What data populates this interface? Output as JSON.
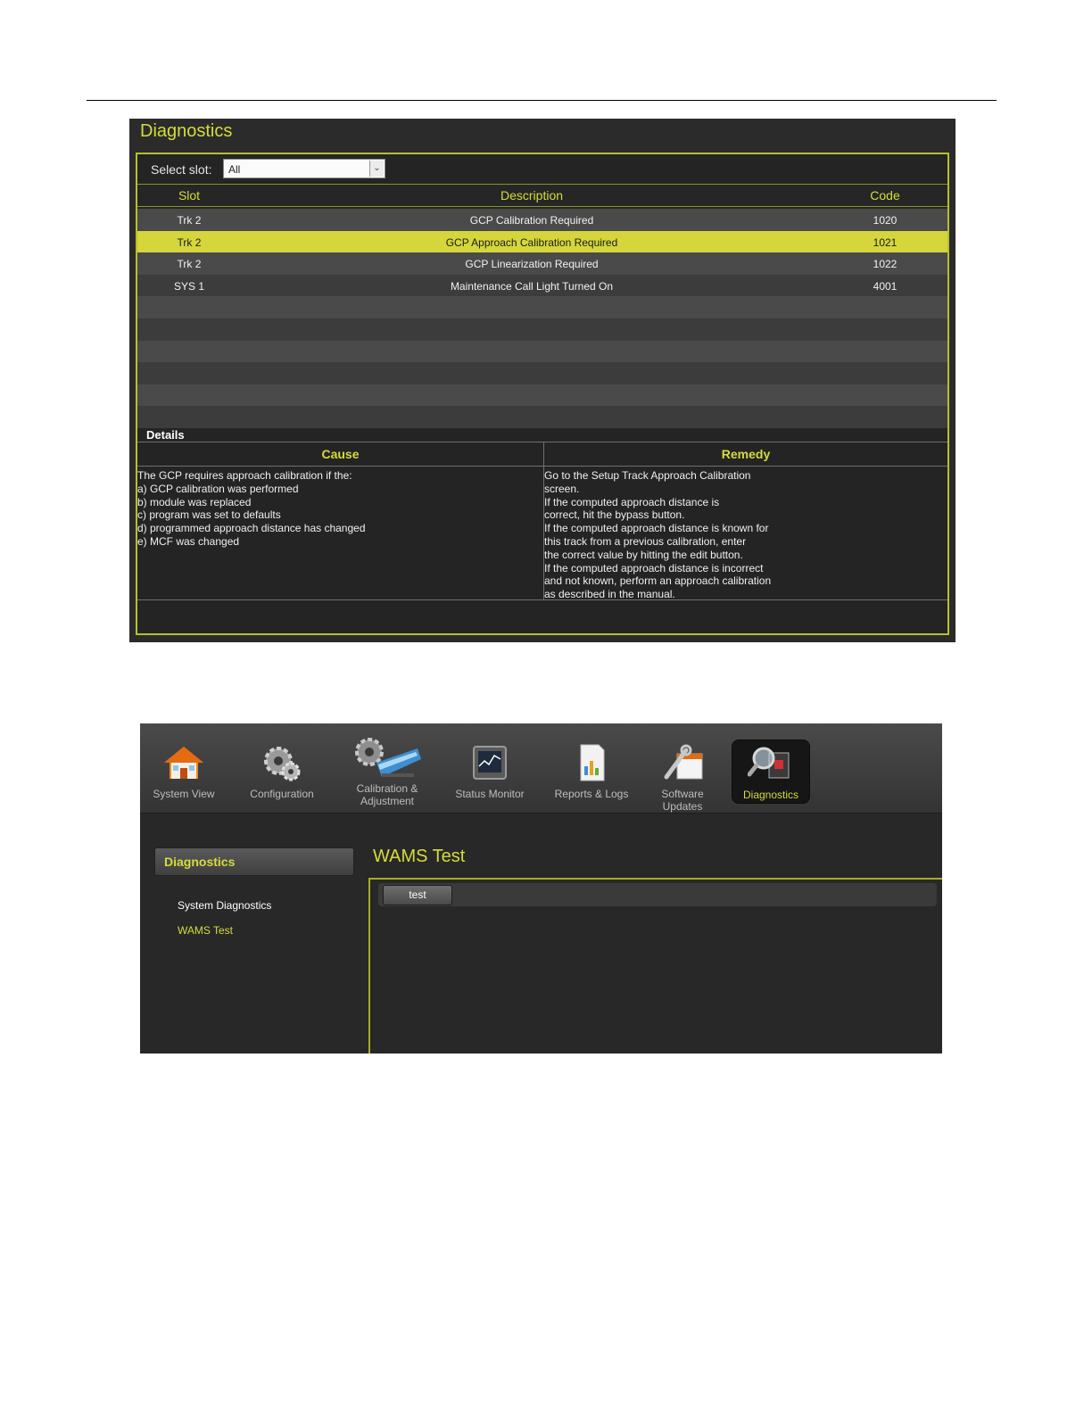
{
  "diagnostics_screen": {
    "title": "Diagnostics",
    "select_slot_label": "Select slot:",
    "select_slot_value": "All",
    "columns": {
      "slot": "Slot",
      "description": "Description",
      "code": "Code"
    },
    "rows": [
      {
        "slot": "Trk 2",
        "description": "GCP Calibration Required",
        "code": "1020",
        "selected": false
      },
      {
        "slot": "Trk 2",
        "description": "GCP Approach Calibration Required",
        "code": "1021",
        "selected": true
      },
      {
        "slot": "Trk 2",
        "description": "GCP Linearization Required",
        "code": "1022",
        "selected": false
      },
      {
        "slot": "SYS 1",
        "description": "Maintenance Call Light Turned On",
        "code": "4001",
        "selected": false
      },
      {
        "slot": "",
        "description": "",
        "code": "",
        "selected": false
      },
      {
        "slot": "",
        "description": "",
        "code": "",
        "selected": false
      },
      {
        "slot": "",
        "description": "",
        "code": "",
        "selected": false
      },
      {
        "slot": "",
        "description": "",
        "code": "",
        "selected": false
      },
      {
        "slot": "",
        "description": "",
        "code": "",
        "selected": false
      },
      {
        "slot": "",
        "description": "",
        "code": "",
        "selected": false
      }
    ],
    "details": {
      "label": "Details",
      "cause_header": "Cause",
      "remedy_header": "Remedy",
      "cause_lines": [
        "The GCP requires approach calibration if the:",
        "a) GCP calibration was performed",
        "b) module was replaced",
        "c) program was set to defaults",
        "d) programmed approach distance has changed",
        "e) MCF was changed"
      ],
      "remedy_lines": [
        "Go to the Setup Track Approach Calibration",
        "screen.",
        "If the computed approach distance is",
        "correct, hit the bypass button.",
        "If the computed approach distance is known for",
        "this track from a previous calibration, enter",
        "the correct value by hitting the edit button.",
        "If the computed approach distance is incorrect",
        "and not known, perform an approach calibration",
        "as described in the manual."
      ]
    }
  },
  "wams_screen": {
    "toolbar": [
      {
        "label": "System View",
        "icon": "house-icon",
        "active": false
      },
      {
        "label": "Configuration",
        "icon": "gears-icon",
        "active": false
      },
      {
        "label": "Calibration & Adjustment",
        "icon": "gear-train-icon",
        "active": false
      },
      {
        "label": "Status Monitor",
        "icon": "monitor-icon",
        "active": false
      },
      {
        "label": "Reports & Logs",
        "icon": "report-document-icon",
        "active": false
      },
      {
        "label": "Software Updates",
        "icon": "wrench-calendar-icon",
        "active": true,
        "active_override": false
      },
      {
        "label": "Diagnostics",
        "icon": "magnifier-icon",
        "active": true
      }
    ],
    "sidebar": {
      "header": "Diagnostics",
      "items": [
        {
          "label": "System Diagnostics",
          "selected": false
        },
        {
          "label": "WAMS Test",
          "selected": true
        }
      ]
    },
    "content": {
      "title": "WAMS Test",
      "tab_label": "test"
    }
  },
  "colors": {
    "accent": "#d6dc3a",
    "highlight_row": "#d4d63c",
    "background": "#2b2b2b"
  }
}
